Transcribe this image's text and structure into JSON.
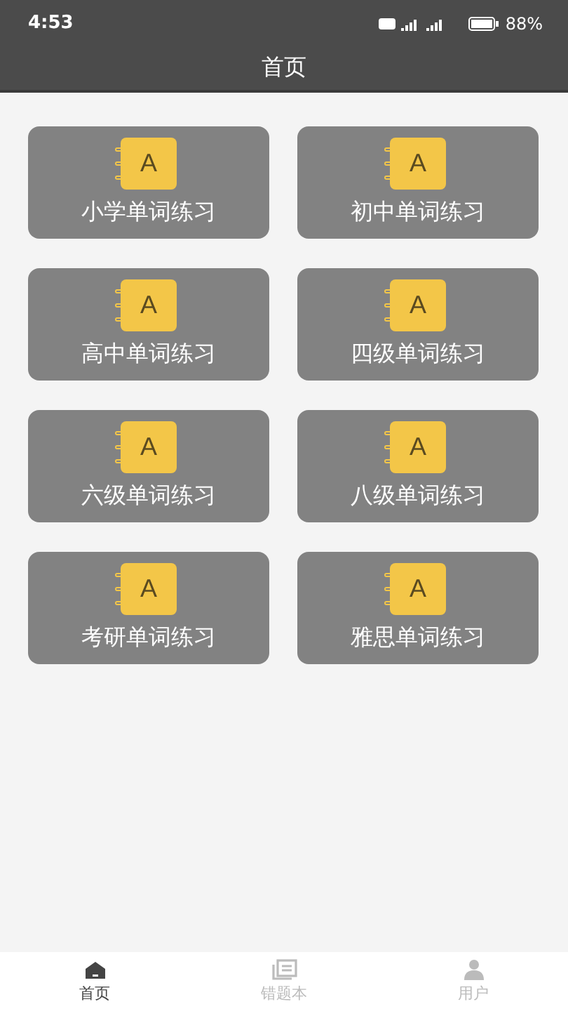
{
  "status_bar": {
    "time": "4:53",
    "battery": "88%"
  },
  "header": {
    "title": "首页"
  },
  "cards": [
    {
      "label": "小学单词练习",
      "icon_letter": "A"
    },
    {
      "label": "初中单词练习",
      "icon_letter": "A"
    },
    {
      "label": "高中单词练习",
      "icon_letter": "A"
    },
    {
      "label": "四级单词练习",
      "icon_letter": "A"
    },
    {
      "label": "六级单词练习",
      "icon_letter": "A"
    },
    {
      "label": "八级单词练习",
      "icon_letter": "A"
    },
    {
      "label": "考研单词练习",
      "icon_letter": "A"
    },
    {
      "label": "雅思单词练习",
      "icon_letter": "A"
    }
  ],
  "tabs": [
    {
      "label": "首页",
      "kind": "home",
      "selected": true
    },
    {
      "label": "错题本",
      "kind": "book",
      "selected": false
    },
    {
      "label": "用户",
      "kind": "user",
      "selected": false
    }
  ]
}
